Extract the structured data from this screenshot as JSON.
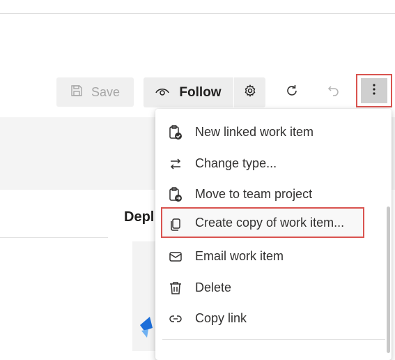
{
  "toolbar": {
    "save_label": "Save",
    "follow_label": "Follow"
  },
  "page": {
    "section_heading": "Depl"
  },
  "menu": {
    "items": [
      {
        "label": "New linked work item",
        "icon": "clipboard-check-icon"
      },
      {
        "label": "Change type...",
        "icon": "swap-arrows-icon"
      },
      {
        "label": "Move to team project",
        "icon": "clipboard-arrow-icon"
      },
      {
        "label": "Create copy of work item...",
        "icon": "copy-icon"
      },
      {
        "label": "Email work item",
        "icon": "mail-icon"
      },
      {
        "label": "Delete",
        "icon": "trash-icon"
      },
      {
        "label": "Copy link",
        "icon": "link-icon"
      }
    ]
  },
  "colors": {
    "highlight_border": "#d9534f",
    "button_bg": "#ededed",
    "text": "#323130"
  }
}
